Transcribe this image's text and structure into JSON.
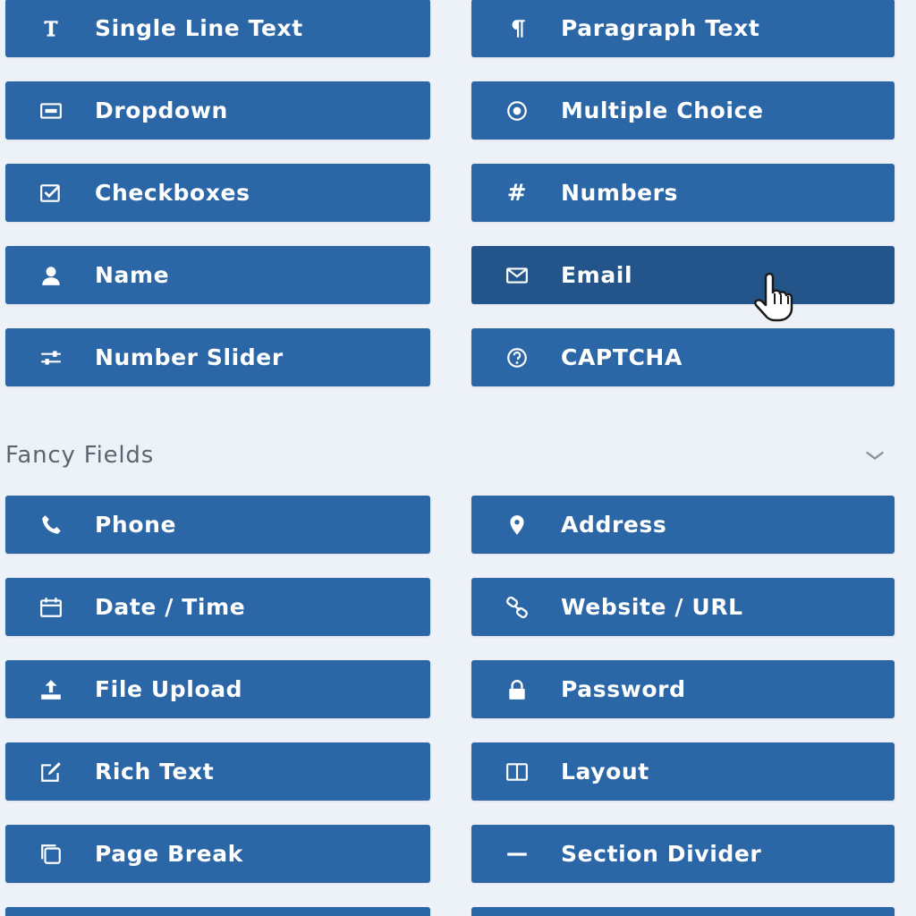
{
  "standard_fields": [
    {
      "label": "Single Line Text",
      "icon": "text-cursor-icon"
    },
    {
      "label": "Paragraph Text",
      "icon": "paragraph-icon"
    },
    {
      "label": "Dropdown",
      "icon": "dropdown-icon"
    },
    {
      "label": "Multiple Choice",
      "icon": "radio-icon"
    },
    {
      "label": "Checkboxes",
      "icon": "checkbox-icon"
    },
    {
      "label": "Numbers",
      "icon": "hash-icon"
    },
    {
      "label": "Name",
      "icon": "user-icon"
    },
    {
      "label": "Email",
      "icon": "envelope-icon"
    },
    {
      "label": "Number Slider",
      "icon": "sliders-icon"
    },
    {
      "label": "CAPTCHA",
      "icon": "question-circle-icon"
    }
  ],
  "fancy_section": {
    "title": "Fancy Fields",
    "toggle_icon": "chevron-down-icon"
  },
  "fancy_fields": [
    {
      "label": "Phone",
      "icon": "phone-icon"
    },
    {
      "label": "Address",
      "icon": "map-marker-icon"
    },
    {
      "label": "Date / Time",
      "icon": "calendar-icon"
    },
    {
      "label": "Website / URL",
      "icon": "link-icon"
    },
    {
      "label": "File Upload",
      "icon": "upload-icon"
    },
    {
      "label": "Password",
      "icon": "lock-icon"
    },
    {
      "label": "Rich Text",
      "icon": "edit-icon"
    },
    {
      "label": "Layout",
      "icon": "columns-icon"
    },
    {
      "label": "Page Break",
      "icon": "copy-icon"
    },
    {
      "label": "Section Divider",
      "icon": "minus-icon"
    }
  ],
  "colors": {
    "button_bg": "#2b66a6",
    "button_hover_bg": "#23548a",
    "page_bg": "#edf2f8",
    "section_title": "#5d6670"
  },
  "hovered_field": "Email"
}
